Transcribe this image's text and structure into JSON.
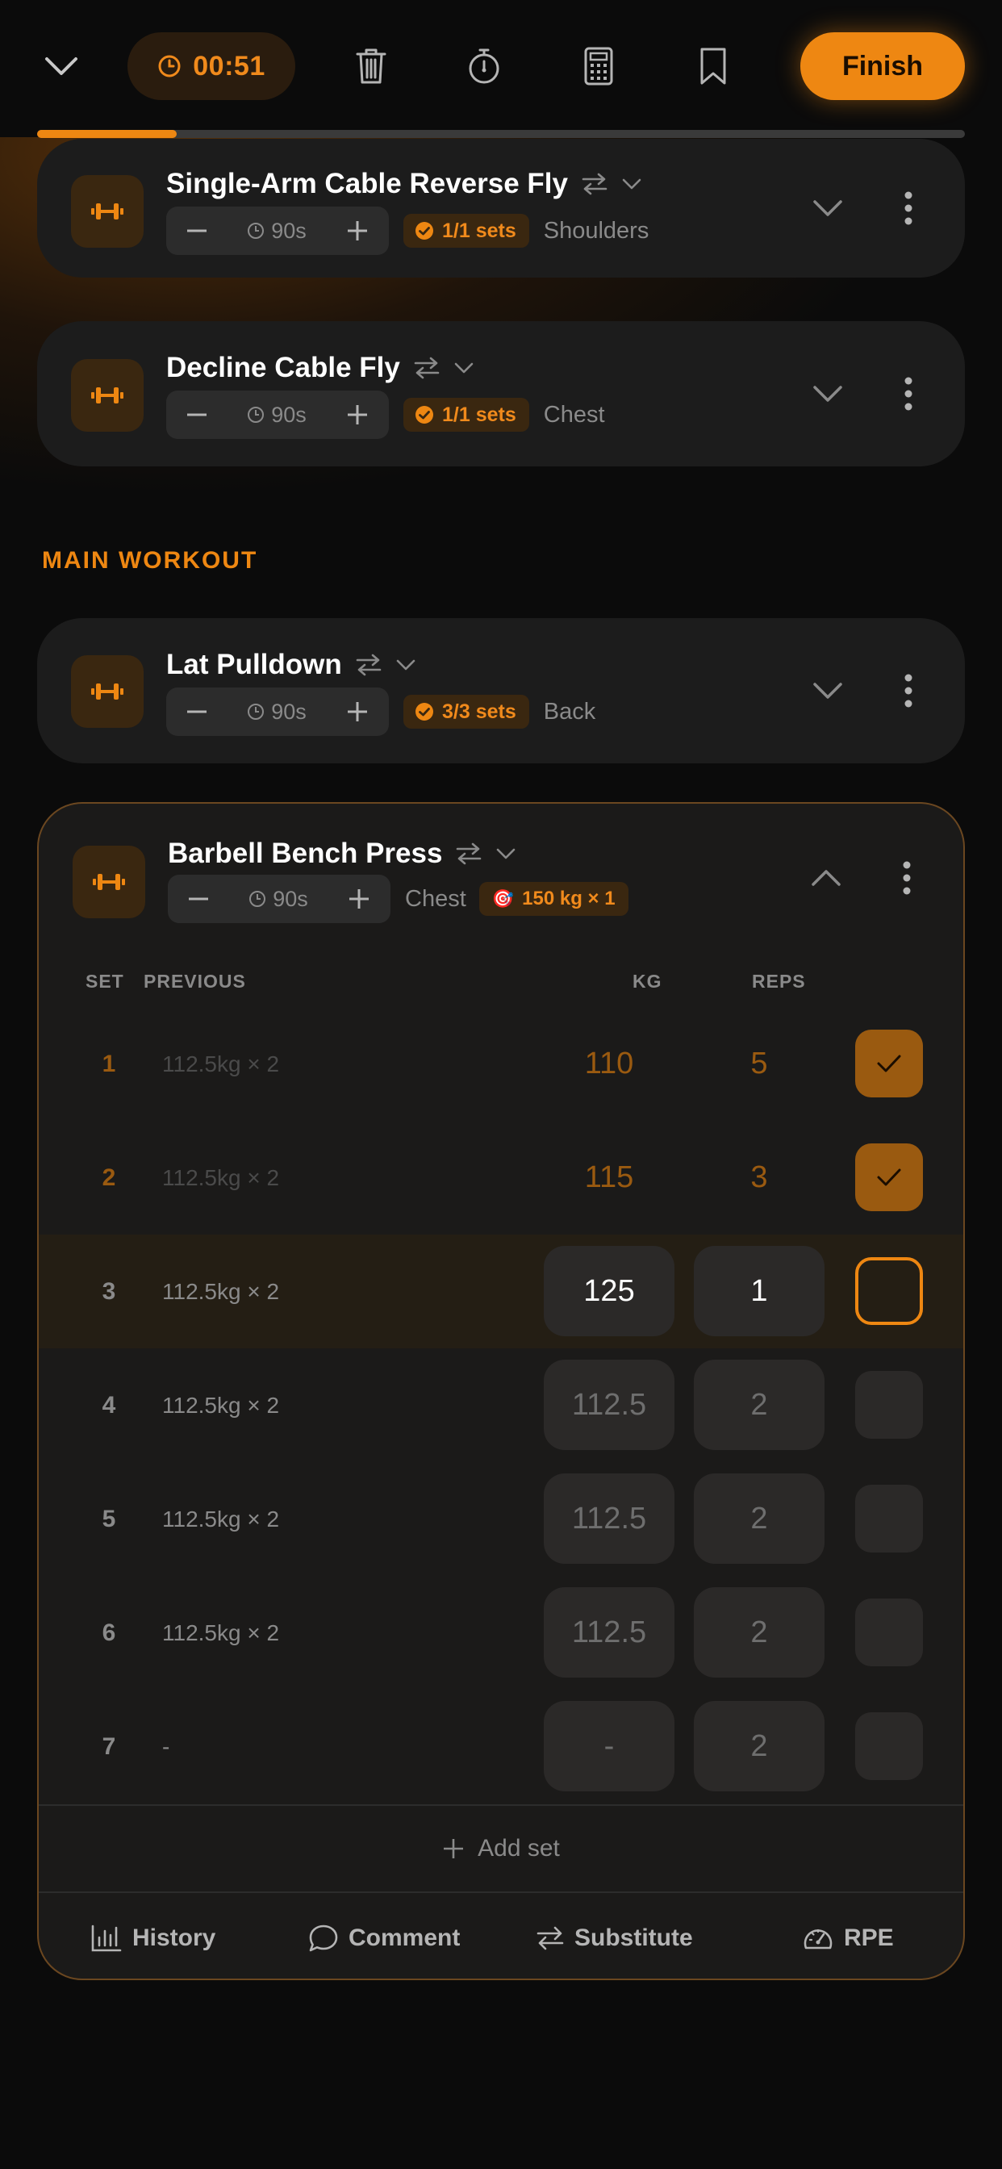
{
  "header": {
    "timer": "00:51",
    "finish_label": "Finish",
    "progress_fraction": 0.15
  },
  "section_label": "MAIN WORKOUT",
  "exercises": [
    {
      "name": "Single-Arm Cable Reverse Fly",
      "rest": "90s",
      "sets_badge": "1/1 sets",
      "muscle": "Shoulders"
    },
    {
      "name": "Decline Cable Fly",
      "rest": "90s",
      "sets_badge": "1/1 sets",
      "muscle": "Chest"
    },
    {
      "name": "Lat Pulldown",
      "rest": "90s",
      "sets_badge": "3/3 sets",
      "muscle": "Back"
    },
    {
      "name": "Barbell Bench Press",
      "rest": "90s",
      "muscle": "Chest",
      "target": "150 kg × 1"
    }
  ],
  "table": {
    "headers": {
      "set": "SET",
      "previous": "PREVIOUS",
      "kg": "KG",
      "reps": "REPS"
    },
    "rows": [
      {
        "set": "1",
        "previous": "112.5kg × 2",
        "kg": "110",
        "reps": "5",
        "state": "done"
      },
      {
        "set": "2",
        "previous": "112.5kg × 2",
        "kg": "115",
        "reps": "3",
        "state": "done"
      },
      {
        "set": "3",
        "previous": "112.5kg × 2",
        "kg": "125",
        "reps": "1",
        "state": "current"
      },
      {
        "set": "4",
        "previous": "112.5kg × 2",
        "kg": "112.5",
        "reps": "2",
        "state": "pending"
      },
      {
        "set": "5",
        "previous": "112.5kg × 2",
        "kg": "112.5",
        "reps": "2",
        "state": "pending"
      },
      {
        "set": "6",
        "previous": "112.5kg × 2",
        "kg": "112.5",
        "reps": "2",
        "state": "pending"
      },
      {
        "set": "7",
        "previous": "-",
        "kg": "-",
        "reps": "2",
        "state": "pending"
      }
    ]
  },
  "add_set_label": "Add set",
  "footer": {
    "history": "History",
    "comment": "Comment",
    "substitute": "Substitute",
    "rpe": "RPE"
  },
  "colors": {
    "accent": "#ee8712",
    "card": "#1c1c1c",
    "background": "#0b0b0b"
  }
}
